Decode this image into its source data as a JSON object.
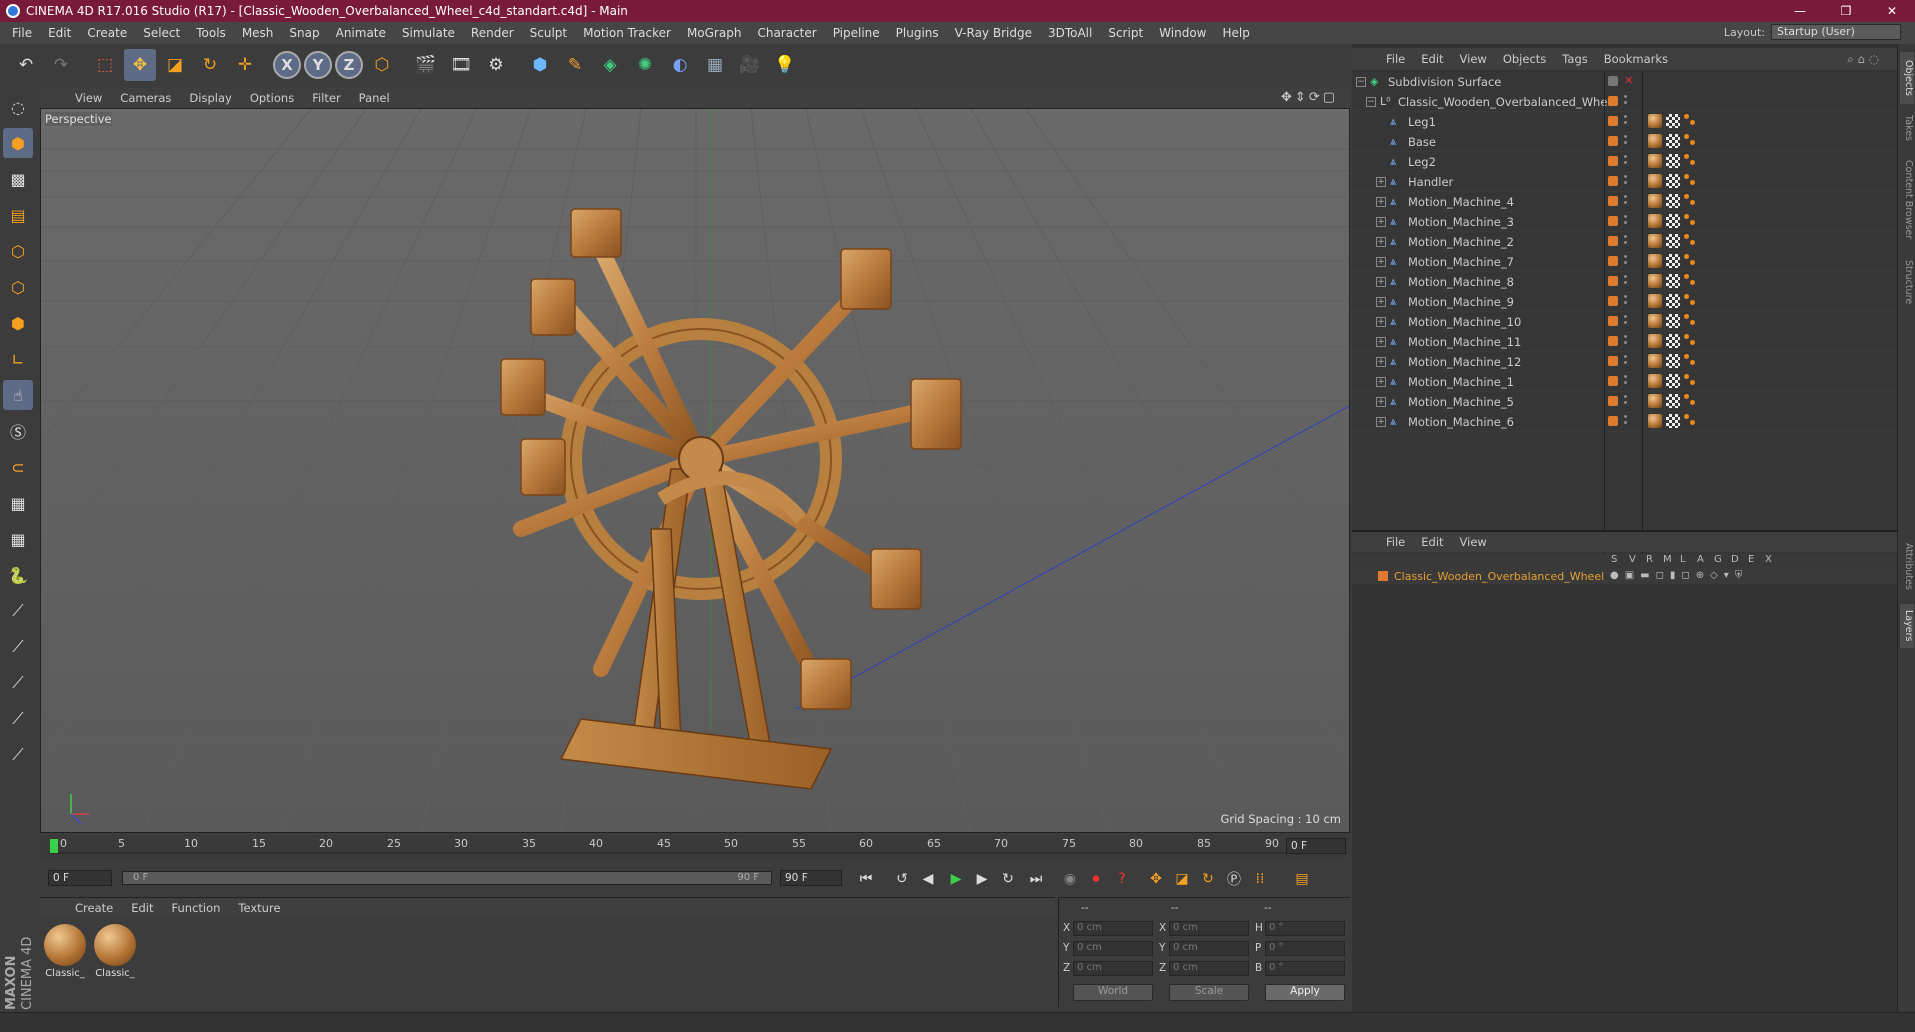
{
  "window": {
    "title": "CINEMA 4D R17.016 Studio (R17) - [Classic_Wooden_Overbalanced_Wheel_c4d_standart.c4d] - Main"
  },
  "menu": [
    "File",
    "Edit",
    "Create",
    "Select",
    "Tools",
    "Mesh",
    "Snap",
    "Animate",
    "Simulate",
    "Render",
    "Sculpt",
    "Motion Tracker",
    "MoGraph",
    "Character",
    "Pipeline",
    "Plugins",
    "V-Ray Bridge",
    "3DToAll",
    "Script",
    "Window",
    "Help"
  ],
  "layout": {
    "label": "Layout:",
    "value": "Startup (User)"
  },
  "viewport": {
    "menu": [
      "View",
      "Cameras",
      "Display",
      "Options",
      "Filter",
      "Panel"
    ],
    "label": "Perspective",
    "grid_spacing": "Grid Spacing : 10 cm"
  },
  "timeline": {
    "ticks": [
      "0",
      "5",
      "10",
      "15",
      "20",
      "25",
      "30",
      "35",
      "40",
      "45",
      "50",
      "55",
      "60",
      "65",
      "70",
      "75",
      "80",
      "85",
      "90"
    ],
    "current_frame": "0 F",
    "start_frame": "0 F",
    "slider_start": "0 F",
    "slider_end": "90 F",
    "end_frame": "90 F"
  },
  "materials": {
    "menu": [
      "Create",
      "Edit",
      "Function",
      "Texture"
    ],
    "items": [
      {
        "label": "Classic_"
      },
      {
        "label": "Classic_"
      }
    ]
  },
  "coords": {
    "headers": [
      "--",
      "--",
      "--"
    ],
    "rows": [
      {
        "l1": "X",
        "v1": "0 cm",
        "l2": "X",
        "v2": "0 cm",
        "l3": "H",
        "v3": "0 °"
      },
      {
        "l1": "Y",
        "v1": "0 cm",
        "l2": "Y",
        "v2": "0 cm",
        "l3": "P",
        "v3": "0 °"
      },
      {
        "l1": "Z",
        "v1": "0 cm",
        "l2": "Z",
        "v2": "0 cm",
        "l3": "B",
        "v3": "0 °"
      }
    ],
    "world": "World",
    "scale": "Scale",
    "apply": "Apply"
  },
  "object_manager": {
    "menu": [
      "File",
      "Edit",
      "View",
      "Objects",
      "Tags",
      "Bookmarks"
    ],
    "objects": [
      {
        "name": "Subdivision Surface"
      },
      {
        "name": "Classic_Wooden_Overbalanced_Wheel"
      },
      {
        "name": "Leg1"
      },
      {
        "name": "Base"
      },
      {
        "name": "Leg2"
      },
      {
        "name": "Handler"
      },
      {
        "name": "Motion_Machine_4"
      },
      {
        "name": "Motion_Machine_3"
      },
      {
        "name": "Motion_Machine_2"
      },
      {
        "name": "Motion_Machine_7"
      },
      {
        "name": "Motion_Machine_8"
      },
      {
        "name": "Motion_Machine_9"
      },
      {
        "name": "Motion_Machine_10"
      },
      {
        "name": "Motion_Machine_11"
      },
      {
        "name": "Motion_Machine_12"
      },
      {
        "name": "Motion_Machine_1"
      },
      {
        "name": "Motion_Machine_5"
      },
      {
        "name": "Motion_Machine_6"
      }
    ]
  },
  "layer_manager": {
    "menu": [
      "File",
      "Edit",
      "View"
    ],
    "columns": [
      "S",
      "V",
      "R",
      "M",
      "L",
      "A",
      "G",
      "D",
      "E",
      "X"
    ],
    "layers": [
      {
        "name": "Classic_Wooden_Overbalanced_Wheel"
      }
    ]
  },
  "side_tabs": [
    "Objects",
    "Takes",
    "Content Browser",
    "Structure",
    "Attributes",
    "Layers"
  ],
  "branding": {
    "brand": "MAXON",
    "product": "CINEMA 4D"
  },
  "colors": {
    "title_bar": "#7a1a3a",
    "selected_tool": "#5d6b86",
    "accent_orange": "#e07a2c",
    "layer_name": "#e8a030"
  }
}
